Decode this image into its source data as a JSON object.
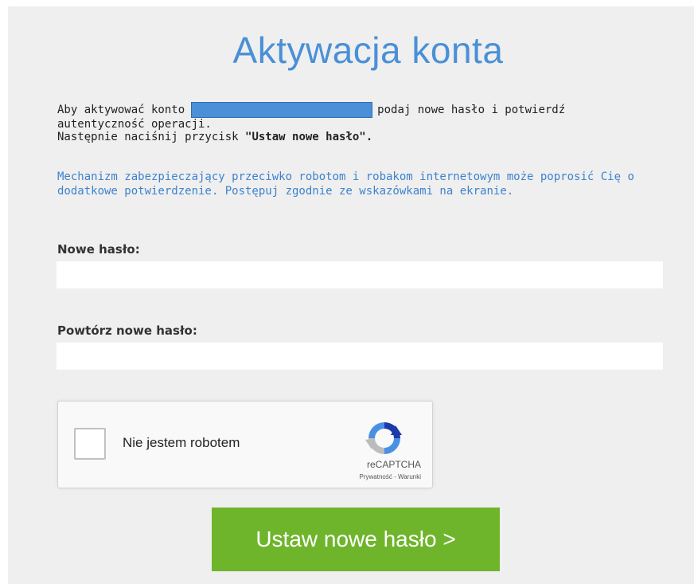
{
  "page": {
    "title": "Aktywacja konta"
  },
  "intro": {
    "line1_before": "Aby aktywować konto",
    "line1_after": "podaj nowe hasło i potwierdź",
    "line2": "autentyczność operacji.",
    "line3_before": "Następnie naciśnij przycisk ",
    "line3_bold": "\"Ustaw nowe hasło\"."
  },
  "info": {
    "text": "Mechanizm zabezpieczający przeciwko robotom i robakom internetowym może poprosić Cię o dodatkowe potwierdzenie. Postępuj zgodnie ze wskazówkami na ekranie."
  },
  "form": {
    "new_password_label": "Nowe hasło:",
    "new_password_value": "",
    "repeat_password_label": "Powtórz nowe hasło:",
    "repeat_password_value": ""
  },
  "captcha": {
    "checkbox_label": "Nie jestem robotem",
    "brand": "reCAPTCHA",
    "terms": "Prywatność - Warunki",
    "logo_icon": "recaptcha-logo-icon"
  },
  "submit": {
    "label": "Ustaw nowe hasło >"
  },
  "colors": {
    "title": "#4a90d6",
    "info_text": "#3e82cc",
    "button": "#6fb52c",
    "panel": "#efefef",
    "redacted": "#4a8fd8"
  }
}
